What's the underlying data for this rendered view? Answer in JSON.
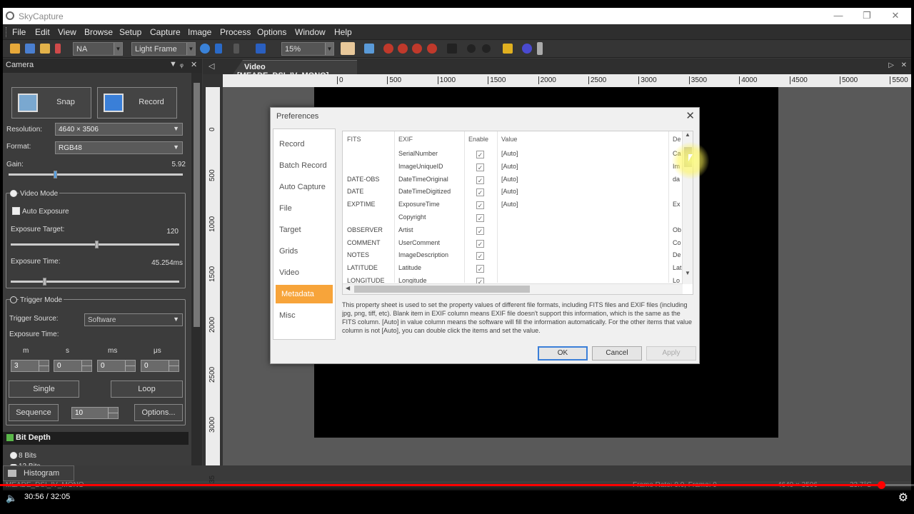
{
  "window": {
    "title": "SkyCapture"
  },
  "menu": [
    "File",
    "Edit",
    "View",
    "Browse",
    "Setup",
    "Capture",
    "Image",
    "Process",
    "Options",
    "Window",
    "Help"
  ],
  "toolbar": {
    "camera_combo": "NA",
    "frame_type_combo": "Light Frame",
    "zoom_combo": "15%",
    "stop_icons_color": "#c0392b"
  },
  "camera_panel": {
    "title": "Camera",
    "snap_label": "Snap",
    "record_label": "Record",
    "resolution_label": "Resolution:",
    "resolution_value": "4640 × 3506",
    "format_label": "Format:",
    "format_value": "RGB48",
    "gain_label": "Gain:",
    "gain_value": "5.92",
    "gain_level": 0.26,
    "video_mode_label": "Video Mode",
    "auto_exposure_label": "Auto Exposure",
    "exposure_target_label": "Exposure Target:",
    "exposure_target_value": "120",
    "exposure_target_level": 0.5,
    "exposure_time_label": "Exposure Time:",
    "exposure_time_value": "45.254ms",
    "exposure_time_level": 0.19,
    "trigger_mode_label": "Trigger Mode",
    "trigger_source_label": "Trigger Source:",
    "trigger_source_value": "Software",
    "trigger_exposure_label": "Exposure Time:",
    "time_units": [
      "m",
      "s",
      "ms",
      "μs"
    ],
    "time_values": [
      "3",
      "0",
      "0",
      "0"
    ],
    "single_label": "Single",
    "loop_label": "Loop",
    "sequence_label": "Sequence",
    "sequence_value": "10",
    "options_label": "Options...",
    "bit_depth_title": "Bit Depth",
    "bit_8_label": "8 Bits",
    "bit_12_label": "12 Bits",
    "bit_depth_color": "#5ab74a"
  },
  "histogram_tab": "Histogram",
  "video_tab": {
    "label": "Video [MEADE_DSI_IV_MONO]"
  },
  "hruler_ticks": [
    "0",
    "500",
    "1000",
    "1500",
    "2000",
    "2500",
    "3000",
    "3500",
    "4000",
    "4500",
    "5000",
    "5500"
  ],
  "vruler_ticks": [
    "0",
    "500",
    "1000",
    "1500",
    "2000",
    "2500",
    "3000",
    "35"
  ],
  "preferences": {
    "title": "Preferences",
    "nav": [
      "Record",
      "Batch Record",
      "Auto Capture",
      "File",
      "Target",
      "Grids",
      "Video",
      "Metadata",
      "Misc"
    ],
    "active_nav": "Metadata",
    "accent": "#f7a43a",
    "columns": [
      "FITS",
      "EXIF",
      "Enable",
      "Value",
      "De"
    ],
    "rows": [
      {
        "fits": "",
        "exif": "SerialNumber",
        "value": "[Auto]",
        "desc": "Ca"
      },
      {
        "fits": "",
        "exif": "ImageUniqueID",
        "value": "[Auto]",
        "desc": "Im"
      },
      {
        "fits": "DATE-OBS",
        "exif": "DateTimeOriginal",
        "value": "[Auto]",
        "desc": "da"
      },
      {
        "fits": "DATE",
        "exif": "DateTimeDigitized",
        "value": "[Auto]",
        "desc": ""
      },
      {
        "fits": "EXPTIME",
        "exif": "ExposureTime",
        "value": "[Auto]",
        "desc": "Ex"
      },
      {
        "fits": "",
        "exif": "Copyright",
        "value": "",
        "desc": ""
      },
      {
        "fits": "OBSERVER",
        "exif": "Artist",
        "value": "",
        "desc": "Ob"
      },
      {
        "fits": "COMMENT",
        "exif": "UserComment",
        "value": "",
        "desc": "Co"
      },
      {
        "fits": "NOTES",
        "exif": "ImageDescription",
        "value": "",
        "desc": "De"
      },
      {
        "fits": "LATITUDE",
        "exif": "Latitude",
        "value": "",
        "desc": "Lat"
      },
      {
        "fits": "LONGITUDE",
        "exif": "Longitude",
        "value": "",
        "desc": "Lo"
      }
    ],
    "description": "This property sheet is used to set the property values of different file formats, including FITS files and EXIF files (including jpg, png, tiff, etc). Blank item in EXIF column means EXIF file doesn't support this information, which is the same as the FITS column. [Auto] in value column means the software will fill the information automatically. For the other items that value column is not [Auto], you can double click the items and set the value.",
    "ok_label": "OK",
    "cancel_label": "Cancel",
    "apply_label": "Apply"
  },
  "status": {
    "camera_name": "MEADE_DSI_IV_MONO",
    "frame_info": "Frame Rate: 0.0, Frame: 0",
    "resolution": "4640 × 3506",
    "temperature": "23.7°C"
  },
  "player": {
    "time": "30:56 / 32:05",
    "progress": 0.964,
    "progress_color": "#ff0000"
  }
}
